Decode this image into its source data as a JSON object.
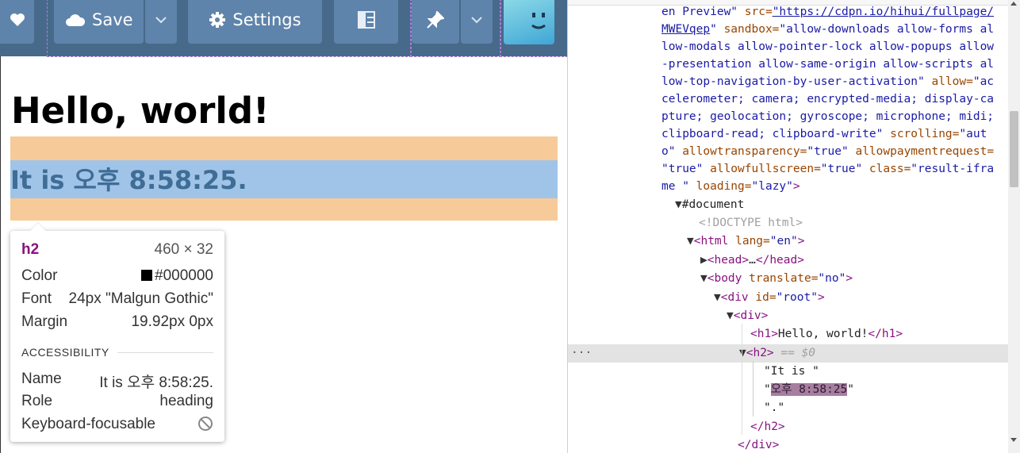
{
  "toolbar": {
    "save_label": "Save",
    "settings_label": "Settings"
  },
  "preview": {
    "heading": "Hello, world!",
    "clock_text": "It is 오후 8:58:25."
  },
  "tooltip": {
    "tag": "h2",
    "size": "460 × 32",
    "color_label": "Color",
    "color_value": "#000000",
    "font_label": "Font",
    "font_value": "24px \"Malgun Gothic\"",
    "margin_label": "Margin",
    "margin_value": "19.92px 0px",
    "accessibility_header": "ACCESSIBILITY",
    "name_label": "Name",
    "name_value": "It is 오후 8:58:25.",
    "role_label": "Role",
    "role_value": "heading",
    "focus_label": "Keyboard-focusable"
  },
  "devtools": {
    "l1a": "en Preview\"",
    "l1b": " src=",
    "l1c": "\"https://cdpn.io/hihui/fullpage/",
    "l2": "MWEVqep",
    "l2b": "\"",
    "l2c": " sandbox=",
    "l2d": "\"allow-downloads allow-forms al",
    "l3": "low-modals allow-pointer-lock allow-popups allow",
    "l4": "-presentation allow-same-origin allow-scripts al",
    "l5a": "low-top-navigation-by-user-activation\"",
    "l5b": " allow=",
    "l5c": "\"ac",
    "l6": "celerometer; camera; encrypted-media; display-ca",
    "l7": "pture; geolocation; gyroscope; microphone; midi;",
    "l8a": "clipboard-read; clipboard-write\"",
    "l8b": " scrolling=",
    "l8c": "\"aut",
    "l9a": "o\"",
    "l9b": " allowtransparency=",
    "l9c": "\"true\"",
    "l9d": " allowpaymentrequest=",
    "l10a": "\"true\"",
    "l10b": " allowfullscreen=",
    "l10c": "\"true\"",
    "l10d": " class=",
    "l10e": "\"result-ifra",
    "l11a": "me \"",
    "l11b": " loading=",
    "l11c": "\"lazy\"",
    "l11d": ">",
    "document": "#document",
    "doctype": "<!DOCTYPE html>",
    "html_open": "<html",
    "html_attr": " lang=",
    "html_val": "\"en\"",
    "html_close": ">",
    "head": "<head>",
    "head_ellipsis": "…",
    "head_close": "</head>",
    "body_open": "<body",
    "body_attr": " translate=",
    "body_val": "\"no\"",
    "body_close": ">",
    "div_root_open": "<div",
    "div_root_attr": " id=",
    "div_root_val": "\"root\"",
    "div_root_close": ">",
    "div_open": "<div>",
    "h1_open": "<h1>",
    "h1_text": "Hello, world!",
    "h1_close": "</h1>",
    "h2_open": "<h2>",
    "h2_eq": " == $0",
    "text1": "\"It is \"",
    "text2_q1": "\"",
    "text2_hl": "오후 8:58:25",
    "text2_q2": "\"",
    "text3": "\".\"",
    "h2_close": "</h2>",
    "div_close": "</div>",
    "dots": "···"
  },
  "colors": {
    "toolbar_bg": "#476a8b",
    "button_bg": "#5f84ab",
    "margin_highlight": "#f7ca9a",
    "content_highlight": "#a0c4e8",
    "tag_color": "#881280",
    "attr_color": "#994500",
    "value_color": "#1a1aa6"
  }
}
